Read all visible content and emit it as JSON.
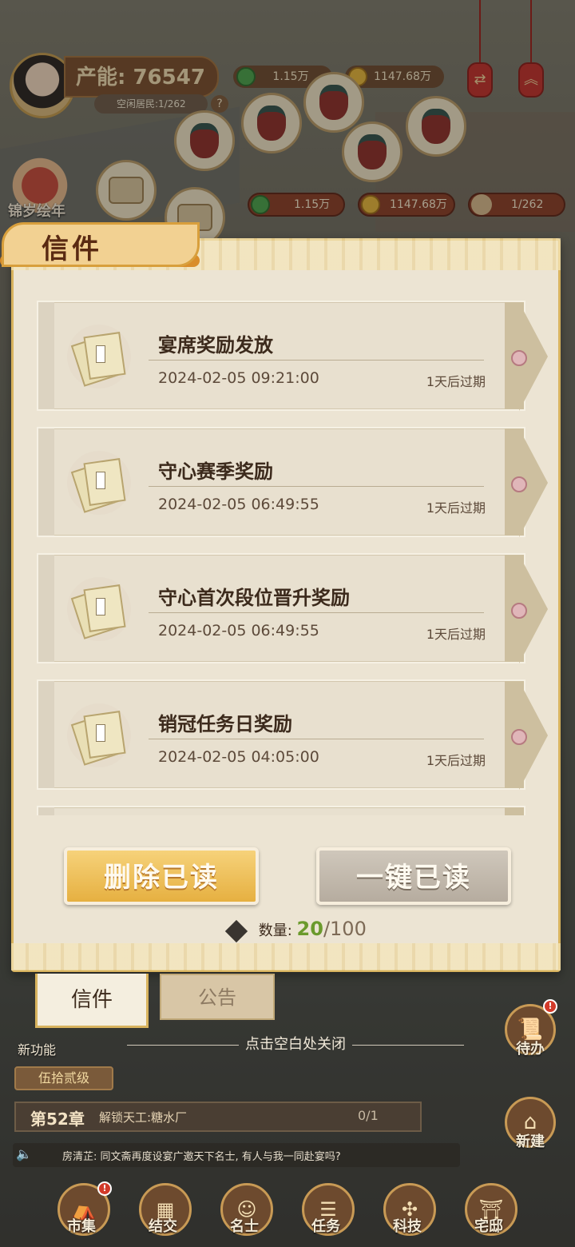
{
  "hud": {
    "production_label": "产能:",
    "production_value": "76547",
    "idle_residents": "空闲居民:1/262",
    "help_icon": "?",
    "jade_top": "1.15万",
    "coin_top": "1147.68万",
    "festival_label": "锦岁绘年",
    "jade": "1.15万",
    "coin": "1147.68万",
    "residents": "1/262"
  },
  "panel": {
    "title": "信件",
    "mails": [
      {
        "title": "宴席奖励发放",
        "time": "2024-02-05   09:21:00",
        "expire": "1天后过期"
      },
      {
        "title": "守心赛季奖励",
        "time": "2024-02-05   06:49:55",
        "expire": "1天后过期"
      },
      {
        "title": "守心首次段位晋升奖励",
        "time": "2024-02-05   06:49:55",
        "expire": "1天后过期"
      },
      {
        "title": "销冠任务日奖励",
        "time": "2024-02-05   04:05:00",
        "expire": "1天后过期"
      }
    ],
    "delete_read": "删除已读",
    "mark_all_read": "一键已读",
    "count_label": "数量:",
    "count_value": "20",
    "count_max": "/100",
    "tabs": {
      "mail": "信件",
      "notice": "公告"
    },
    "close_hint": "点击空白处关闭"
  },
  "bottom": {
    "new_feature": "新功能",
    "rank": "伍拾贰级",
    "chapter": "第52章",
    "chapter_task": "解锁天工:糖水厂",
    "chapter_progress": "0/1",
    "chat": "房清芷: 同文斋再度设宴广邀天下名士, 有人与我一同赴宴吗?",
    "todo": "待办",
    "build": "新建",
    "nav": [
      "市集",
      "结交",
      "名士",
      "任务",
      "科技",
      "宅邸"
    ]
  },
  "colors": {
    "accent": "#d89f3c",
    "count_green": "#6b9a2c",
    "panel_bg": "#ece4d3"
  }
}
